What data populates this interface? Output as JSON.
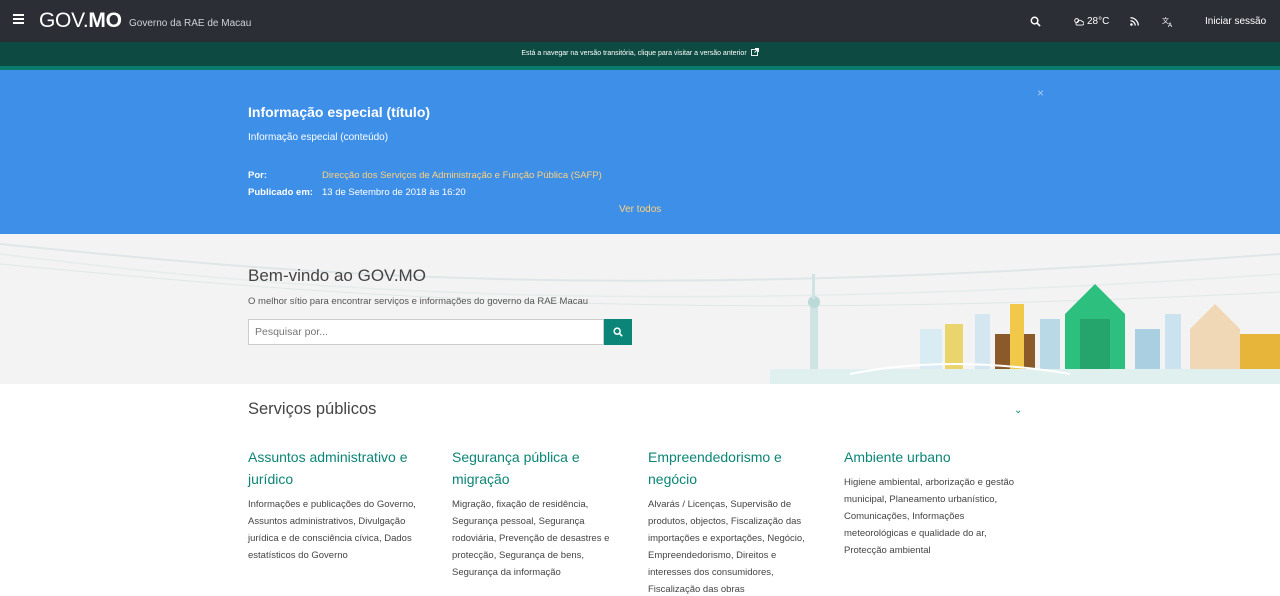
{
  "nav": {
    "logo_gov": "GOV.",
    "logo_mo": "MO",
    "subtitle": "Governo da RAE de Macau",
    "weather": "28°C",
    "login": "Iniciar sessão"
  },
  "transition": {
    "text": "Está a navegar na versão transitória, clique para visitar a versão anterior"
  },
  "special": {
    "title": "Informação especial (título)",
    "content": "Informação especial (conteúdo)",
    "by_label": "Por:",
    "by_value": "Direcção dos Serviços de Administração e Função Pública (SAFP)",
    "published_label": "Publicado em:",
    "published_value": "13 de Setembro de 2018 às 16:20",
    "see_all": "Ver todos",
    "close": "×"
  },
  "welcome": {
    "title": "Bem-vindo ao GOV.MO",
    "subtitle": "O melhor sítio para encontrar serviços e informações do governo da RAE Macau",
    "search_placeholder": "Pesquisar por..."
  },
  "services": {
    "title": "Serviços públicos",
    "items": [
      {
        "title": "Assuntos administrativo e jurídico",
        "description": "Informações e publicações do Governo, Assuntos administrativos, Divulgação jurídica e de consciência cívica, Dados estatísticos do Governo"
      },
      {
        "title": "Segurança pública e migração",
        "description": "Migração, fixação de residência, Segurança pessoal, Segurança rodoviária, Prevenção de desastres e protecção, Segurança de bens, Segurança da informação"
      },
      {
        "title": "Empreendedorismo e negócio",
        "description": "Alvarás / Licenças, Supervisão de produtos, objectos, Fiscalização das importações e exportações, Negócio, Empreendedorismo, Direitos e interesses dos consumidores, Fiscalização das obras"
      },
      {
        "title": "Ambiente urbano",
        "description": "Higiene ambiental, arborização e gestão municipal, Planeamento urbanístico, Comunicações, Informações meteorológicas e qualidade do ar, Protecção ambiental"
      }
    ]
  },
  "colors": {
    "nav_bg": "#2b2e35",
    "transition_bg": "#0d4b42",
    "special_bg": "#3d8fe8",
    "accent_teal": "#0b8577",
    "link_yellow": "#ffd27a"
  }
}
